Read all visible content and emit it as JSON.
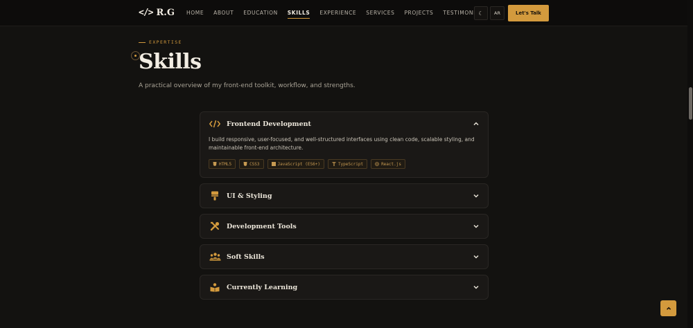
{
  "header": {
    "logo_glyph": "</>",
    "logo_text": "R.G",
    "nav": [
      "HOME",
      "ABOUT",
      "EDUCATION",
      "SKILLS",
      "EXPERIENCE",
      "SERVICES",
      "PROJECTS",
      "TESTIMONIALS"
    ],
    "active_nav": "SKILLS",
    "theme_icon": "☾",
    "lang_label": "AR",
    "cta_label": "Let's Talk"
  },
  "intro": {
    "eyebrow": "EXPERTISE",
    "title": "Skills",
    "subtitle": "A practical overview of my front-end toolkit, workflow, and strengths."
  },
  "skills": [
    {
      "icon": "code-icon",
      "title": "Frontend Development",
      "open": true,
      "description": "I build responsive, user-focused, and well-structured interfaces using clean code, scalable styling, and maintainable front-end architecture.",
      "tags": [
        {
          "icon": "html5-icon",
          "label": "HTML5"
        },
        {
          "icon": "css3-icon",
          "label": "CSS3"
        },
        {
          "icon": "javascript-icon",
          "label": "JavaScript (ES6+)"
        },
        {
          "icon": "typescript-icon",
          "label": "TypeScript"
        },
        {
          "icon": "react-icon",
          "label": "React.js"
        }
      ]
    },
    {
      "icon": "paint-roller-icon",
      "title": "UI & Styling",
      "open": false
    },
    {
      "icon": "tools-icon",
      "title": "Development Tools",
      "open": false
    },
    {
      "icon": "team-icon",
      "title": "Soft Skills",
      "open": false
    },
    {
      "icon": "book-reader-icon",
      "title": "Currently Learning",
      "open": false
    }
  ],
  "colors": {
    "accent": "#d39a3d",
    "background": "#131210",
    "panel": "#1a1816"
  }
}
